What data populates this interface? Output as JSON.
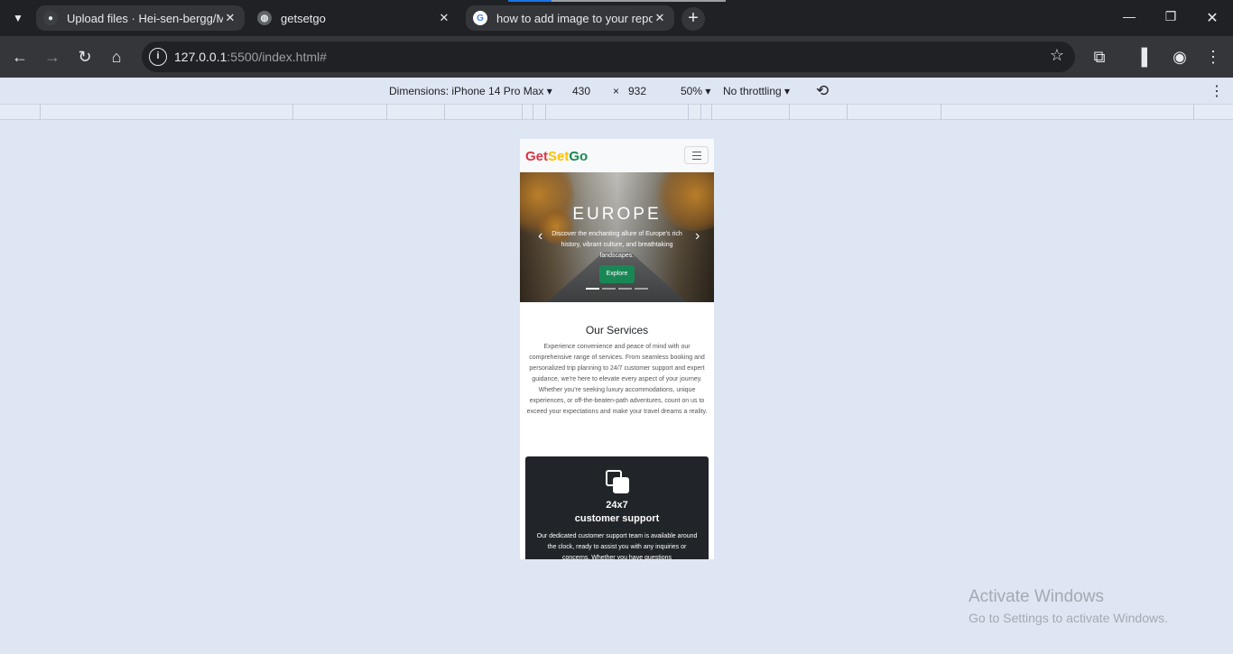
{
  "tabs": [
    {
      "title": "Upload files · Hei-sen-bergg/M",
      "close": "✕",
      "icon": "github-icon"
    },
    {
      "title": "getsetgo",
      "close": "✕",
      "icon": "globe-icon"
    },
    {
      "title": "how to add image to your repo",
      "close": "✕",
      "icon": "google-icon"
    }
  ],
  "address_bar": {
    "host": "127.0.0.1",
    "rest": ":5500/index.html#"
  },
  "device_toolbar": {
    "dimensions": "Dimensions: iPhone 14 Pro Max",
    "width": "430",
    "times": "×",
    "height": "932",
    "zoom": "50%",
    "throttling": "No throttling"
  },
  "site": {
    "brand": {
      "part1": "Get",
      "part2": "Set",
      "part3": "Go"
    },
    "brand_colors": {
      "get": "#dc3545",
      "set": "#ffc107",
      "go": "#198754"
    },
    "hero": {
      "title": "EUROPE",
      "text": "Discover the enchanting allure of Europe's rich history, vibrant culture, and breathtaking landscapes.",
      "button": "Explore",
      "prev": "‹",
      "next": "›"
    },
    "services": {
      "title": "Our Services",
      "text": "Experience convenience and peace of mind with our comprehensive range of services. From seamless booking and personalized trip planning to 24/7 customer support and expert guidance, we're here to elevate every aspect of your journey. Whether you're seeking luxury accommodations, unique experiences, or off-the-beaten-path adventures, count on us to exceed your expectations and make your travel dreams a reality."
    },
    "card": {
      "title_line1": "24x7",
      "title_line2": "customer support",
      "text": "Our dedicated customer support team is available around the clock, ready to assist you with any inquiries or concerns. Whether you have questions"
    }
  },
  "watermark": {
    "line1": "Activate Windows",
    "line2": "Go to Settings to activate Windows."
  }
}
